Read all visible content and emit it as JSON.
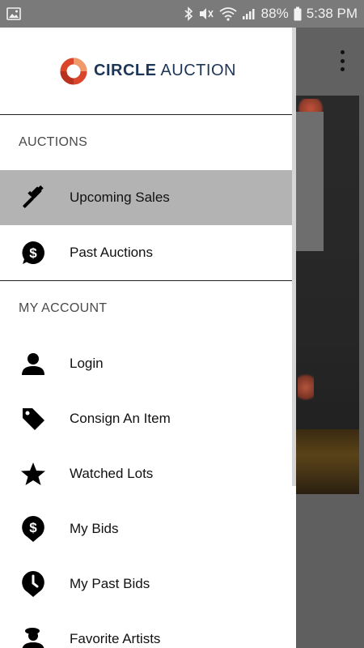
{
  "status_bar": {
    "battery": "88%",
    "time": "5:38 PM"
  },
  "logo": {
    "bold": "CIRCLE",
    "rest": "AUCTION"
  },
  "sections": [
    {
      "label": "AUCTIONS",
      "items": [
        {
          "label": "Upcoming Sales",
          "icon": "gavel-icon",
          "active": true
        },
        {
          "label": "Past Auctions",
          "icon": "dollar-bubble-icon",
          "active": false
        }
      ]
    },
    {
      "label": "MY ACCOUNT",
      "items": [
        {
          "label": "Login",
          "icon": "person-icon"
        },
        {
          "label": "Consign An Item",
          "icon": "tag-icon"
        },
        {
          "label": "Watched Lots",
          "icon": "star-icon"
        },
        {
          "label": "My Bids",
          "icon": "dollar-pin-icon"
        },
        {
          "label": "My Past Bids",
          "icon": "clock-pin-icon"
        },
        {
          "label": "Favorite Artists",
          "icon": "artist-icon"
        }
      ]
    }
  ],
  "colors": {
    "logo_ring_outer": "#d9462b",
    "logo_ring_inner": "#ee9a6a",
    "logo_text": "#1d3557",
    "active_item_bg": "#b3b3b3"
  }
}
